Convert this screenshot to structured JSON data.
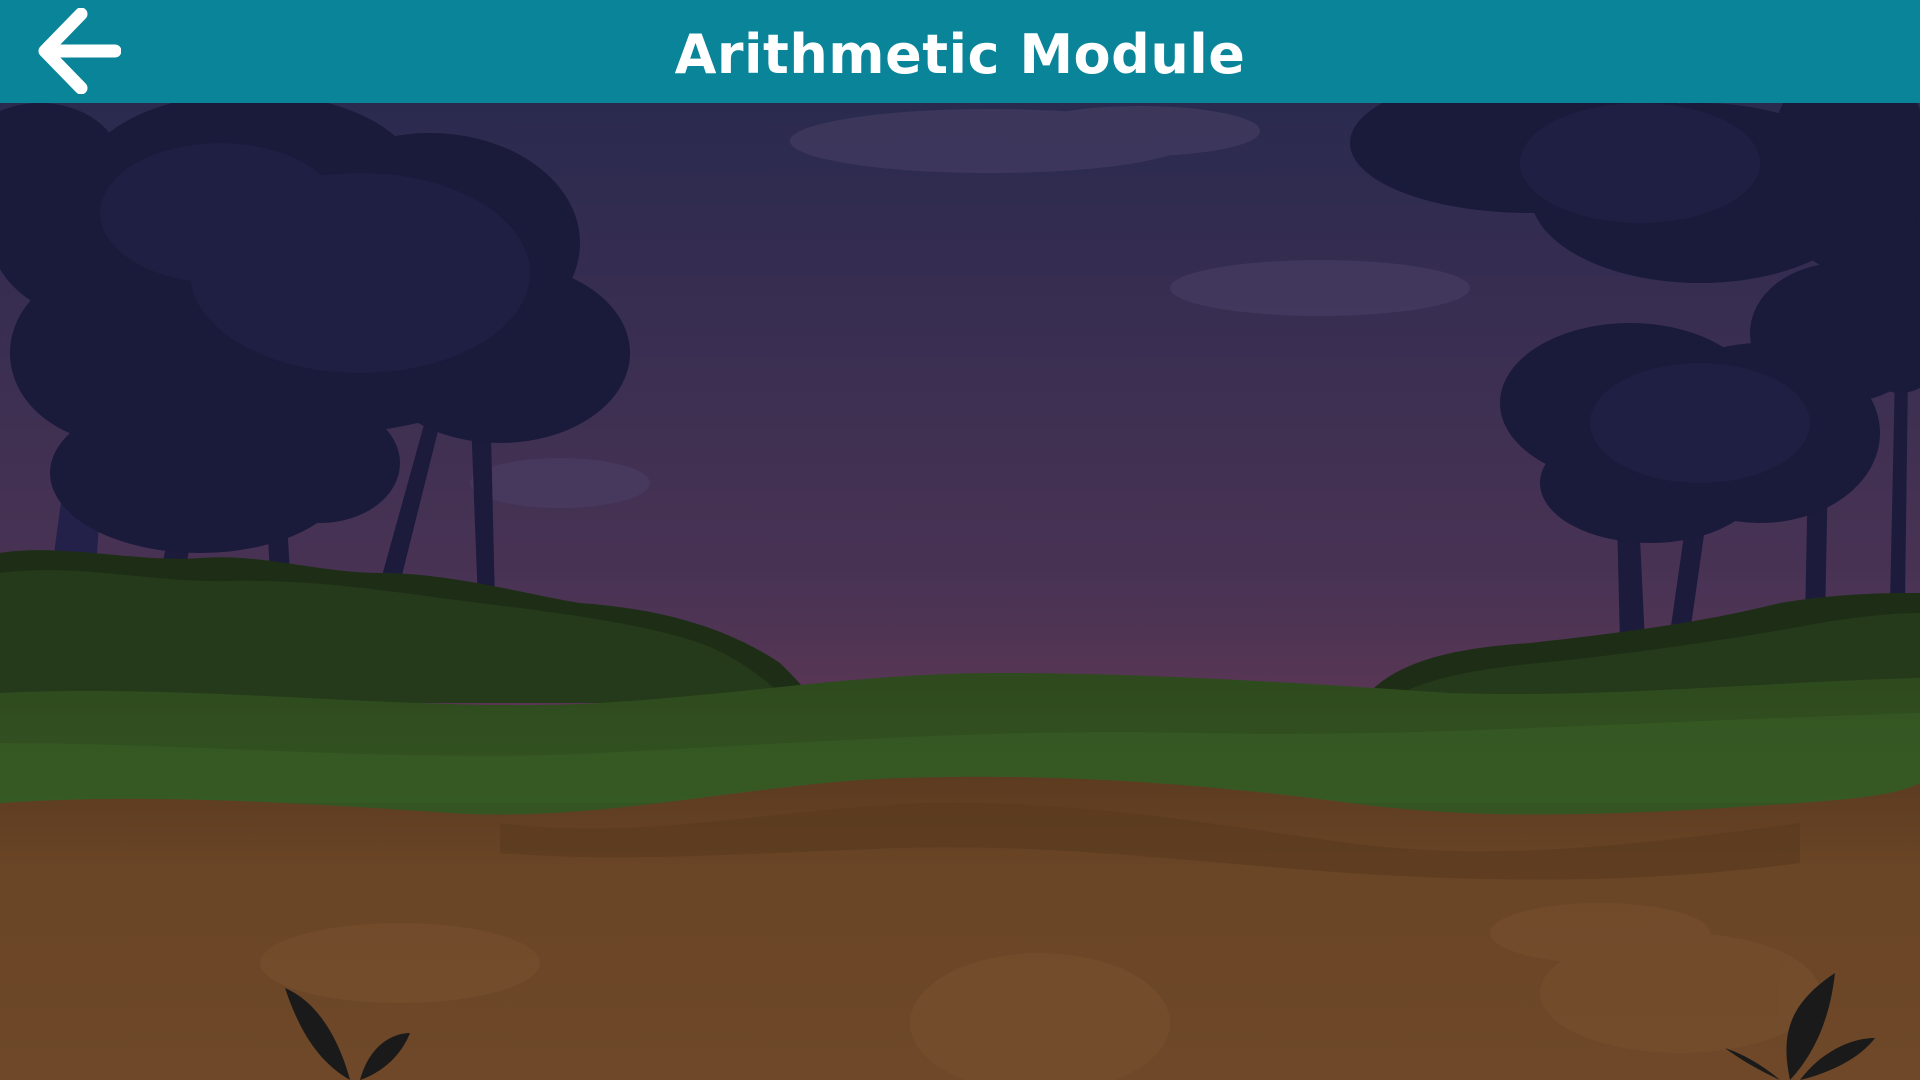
{
  "header": {
    "title": "Arithmetic Module",
    "back_icon": "arrow-left-icon",
    "background_color": "#0a8499",
    "text_color": "#ffffff"
  },
  "scene": {
    "sky_top_color": "#2b2a4e",
    "sky_bottom_color": "#6a3a54",
    "grass_color": "#2f4b1f",
    "dirt_color": "#6a4526"
  }
}
